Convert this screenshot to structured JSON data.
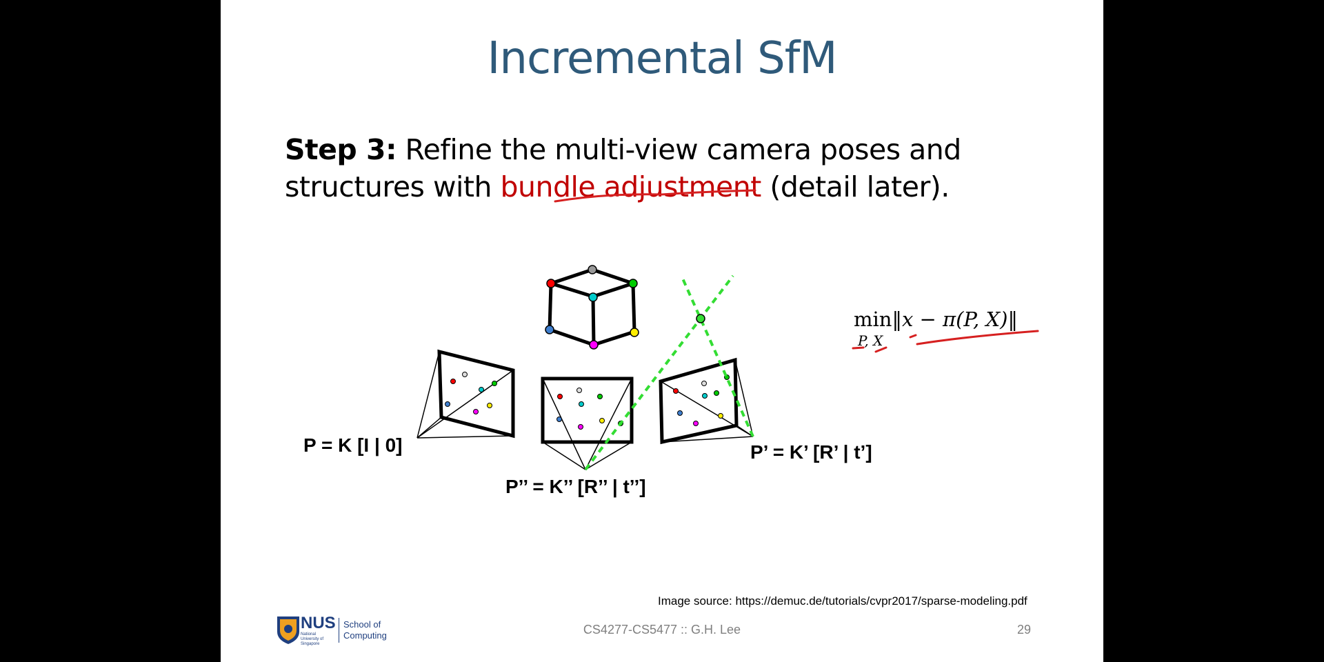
{
  "slide": {
    "title": "Incremental SfM",
    "step_label": "Step 3:",
    "step_text_1": " Refine the multi-view camera poses and structures with ",
    "step_highlight": "bundle adjustment",
    "step_text_2": " (detail later).",
    "highlight_color": "#c00000",
    "title_color": "#2f5a7a"
  },
  "diagram": {
    "camera_left_label": "P = K [I | 0]",
    "camera_middle_label": "P’’ = K’’ [R’’ | t’’]",
    "camera_right_label": "P’ = K’ [R’ | t’]",
    "point_colors": [
      "#ff0000",
      "#999999",
      "#00cc00",
      "#00cccc",
      "#3f7fcf",
      "#ff00ff",
      "#ffee00"
    ]
  },
  "formula": {
    "operator": "min",
    "subscript": "P, X",
    "expression": "‖x − π(P, X)‖"
  },
  "footer": {
    "image_source": "Image source: https://demuc.de/tutorials/cvpr2017/sparse-modeling.pdf",
    "course": "CS4277-CS5477 :: G.H. Lee",
    "page_number": "29",
    "logo_text": "NUS",
    "logo_subtext": "National University of Singapore",
    "department": "School of Computing"
  }
}
